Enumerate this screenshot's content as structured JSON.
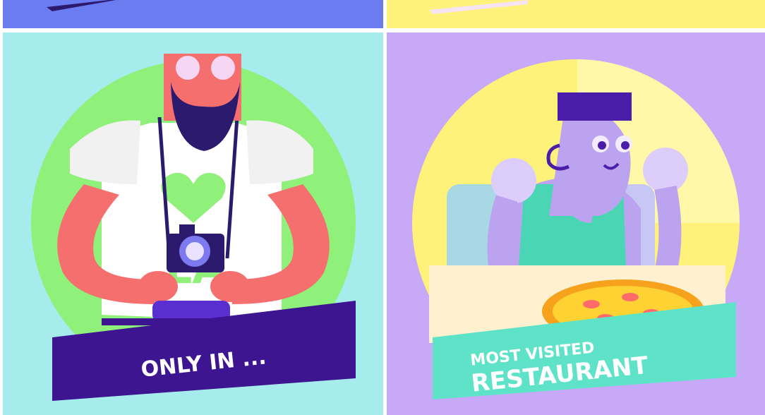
{
  "panels": {
    "top_left": {
      "bg": "#6b7bf0"
    },
    "top_right": {
      "bg": "#fff27a"
    },
    "bottom_left": {
      "bg": "#a6ecec",
      "circle_color": "#8ff07a",
      "banner_color": "#3d1590",
      "banner_text": "ONLY IN ...",
      "shirt_symbol": "♥"
    },
    "bottom_right": {
      "bg": "#c8a9f7",
      "circle_color": "#fff27a",
      "banner_color": "#5fe3c8",
      "banner_line1": "MOST VISITED",
      "banner_line2": "RESTAURANT"
    }
  },
  "icons": [
    "camera-icon",
    "heart-icon",
    "pizza-icon"
  ]
}
